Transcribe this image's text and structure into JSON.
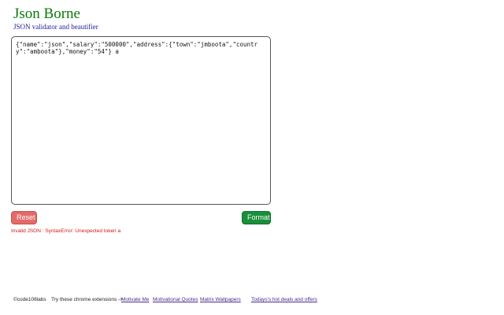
{
  "header": {
    "title": "Json Borne",
    "subtitle": "JSON validator and beautifier"
  },
  "editor": {
    "value": "{\"name\":\"json\",\"salary\":\"500000\",\"address\":{\"town\":\"jmboota\",\"country\":\"amboota\"},\"money\":\"54\"} a"
  },
  "actions": {
    "reset_label": "Reset",
    "format_label": "Format"
  },
  "status": {
    "error": "Invalid JSON : SyntaxError: Unexpected token a"
  },
  "footer": {
    "copyright": "©code108labs",
    "extensions_prompt": "Try these chrome extensions ->",
    "links": [
      {
        "label": "Motivate Me"
      },
      {
        "label": "Motivational Quotes"
      },
      {
        "label": "Matrix Wallpapers"
      },
      {
        "label": "Todays's hot deals and offers"
      }
    ]
  },
  "colors": {
    "title": "#0a7a0a",
    "subtitle": "#1a1a9a",
    "reset_button": "#e36a6a",
    "format_button": "#1a8f3a",
    "error_text": "#d01818",
    "link": "#4a2a8a"
  }
}
